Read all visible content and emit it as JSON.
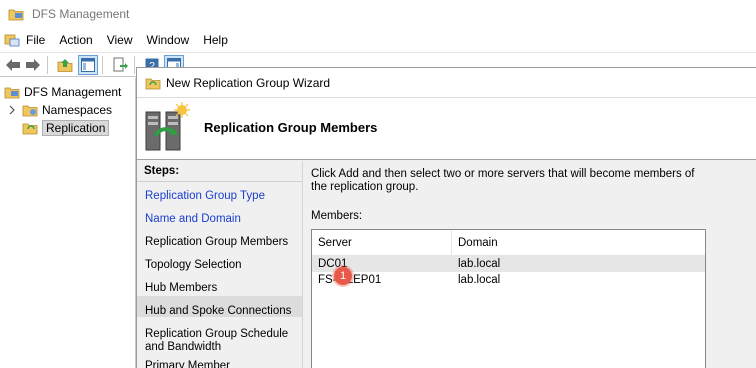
{
  "window": {
    "title": "DFS Management"
  },
  "menu": [
    "File",
    "Action",
    "View",
    "Window",
    "Help"
  ],
  "toolbar": {
    "buttons": [
      "back-arrow-icon",
      "forward-arrow-icon",
      "up-folder-icon",
      "show-hide-console-tree-icon",
      "export-list-icon",
      "help-icon",
      "action-pane-icon"
    ]
  },
  "tree": {
    "root": "DFS Management",
    "children": [
      "Namespaces",
      "Replication"
    ],
    "selected": "Replication"
  },
  "wizard": {
    "title": "New Replication Group Wizard",
    "header": "Replication Group Members",
    "steps_heading": "Steps:",
    "steps": [
      "Replication Group Type",
      "Name and Domain",
      "Replication Group Members",
      "Topology Selection",
      "Hub Members",
      "Hub and Spoke Connections",
      "Replication Group Schedule and Bandwidth",
      "Primary Member"
    ],
    "current_step": "Replication Group Members",
    "instruction": "Click Add and then select two or more servers that will become members of the replication group.",
    "members_label": "Members:",
    "columns": [
      "Server",
      "Domain"
    ],
    "rows": [
      {
        "server": "DC01",
        "domain": "lab.local"
      },
      {
        "server": "FS-FILEP01",
        "domain": "lab.local"
      }
    ],
    "badge": "1"
  },
  "colors": {
    "link": "#1a3dd0",
    "badge": "#e8594a",
    "selection": "#d9d9d9"
  }
}
